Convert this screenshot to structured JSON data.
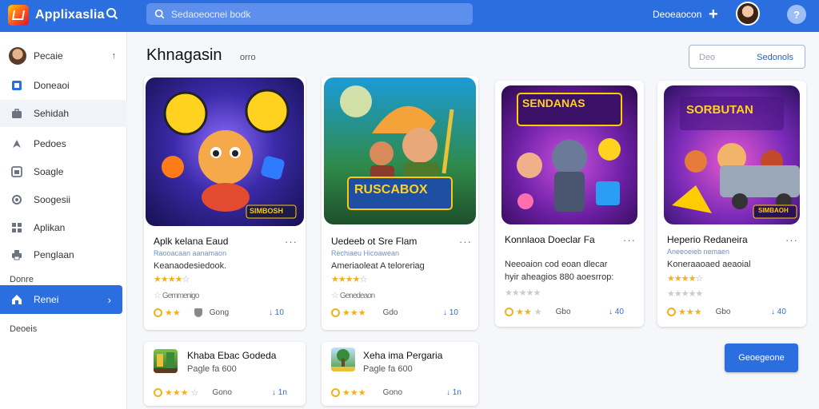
{
  "app": {
    "title": "Applixaslia"
  },
  "topbar": {
    "search_placeholder": "Sedaoeocnei bodk",
    "link": "Deoeaocon",
    "plus": "+",
    "help": "?"
  },
  "sidebar": {
    "items": [
      {
        "label": "Pecaie",
        "icon": "avatar",
        "extra": "↑"
      },
      {
        "label": "Doneaoi",
        "icon": "image-icon"
      },
      {
        "label": "Sehidah",
        "icon": "briefcase-icon"
      },
      {
        "label": "Pedoes",
        "icon": "rocket-icon"
      },
      {
        "label": "Soagle",
        "icon": "image-icon"
      },
      {
        "label": "Soogesii",
        "icon": "circle-icon"
      },
      {
        "label": "Aplikan",
        "icon": "grid-icon"
      },
      {
        "label": "Penglaan",
        "icon": "printer-icon"
      }
    ],
    "heading_1": "Donre",
    "active_item": {
      "label": "Renei",
      "icon": "home-icon",
      "chevron": "›"
    },
    "heading_2": "Deoeis"
  },
  "main": {
    "title": "Khnagasin",
    "subtitle": "orro",
    "outline_button": {
      "placeholder": "Deo",
      "label": "Sedonols"
    },
    "primary_button": "Geoegeone"
  },
  "cards": [
    {
      "title": "Aplk kelana Eaud",
      "more": "···",
      "line1": "Raooacaan aanamaon",
      "line2": "Keanaodesiedook.",
      "rating_stars": 4,
      "rating_text": "",
      "row2_text": "Gemmenigo",
      "row2_stars": 0,
      "footer": {
        "stars": 2,
        "text": "Gong",
        "download": "↓ 10"
      },
      "thumb_badge": "SIMBOSH"
    },
    {
      "title": "Uedeeb ot Sre Flam",
      "more": "···",
      "line1": "Rechiaeu Hicoawean",
      "line2": "Ameriaoleat A teloreriag",
      "rating_stars": 4,
      "rating_text": "",
      "row2_text": "Genedeaon",
      "row2_stars": 0,
      "footer": {
        "stars": 3,
        "text": "Gdo",
        "download": "↓ 10"
      },
      "thumb_badge": "RUSCABOX"
    },
    {
      "title": "Konnlaoa Doeclar Fa",
      "more": "···",
      "line1": "",
      "line2": "Neeoaion cod eoan dlecar",
      "line3": "hyir aheagios 880 aoesrrop:",
      "rating_stars": 0,
      "rating_text": "",
      "row2_text": "",
      "row2_stars": 5,
      "footer": {
        "stars": 2,
        "text": "Gbo",
        "download": "↓ 40"
      },
      "thumb_badge": "SENDANAS"
    },
    {
      "title": "Heperio Redaneira",
      "more": "···",
      "line1": "Aneeoeieb nemaen",
      "line2": "Koneraaoaed aeaoial",
      "rating_stars": 4,
      "rating_text": "",
      "row2_text": "",
      "row2_stars": 5,
      "footer": {
        "stars": 3,
        "text": "Gbo",
        "download": "↓ 40"
      },
      "thumb_badge": "SIMBAOH"
    },
    {
      "title": "Khaba Ebac Godeda",
      "more": "",
      "line1": "Pagle fa 600",
      "line2": "",
      "rating_stars": 0,
      "rating_text": "",
      "row2_text": "",
      "row2_stars": 0,
      "footer": {
        "stars": 4,
        "text": "Gono",
        "download": "↓ 1n"
      },
      "thumb_badge": ""
    },
    {
      "title": "Xeha ima Pergaria",
      "more": "",
      "line1": "Pagle fa 600",
      "line2": "",
      "rating_stars": 0,
      "rating_text": "",
      "row2_text": "",
      "row2_stars": 0,
      "footer": {
        "stars": 3,
        "text": "Gono",
        "download": "↓ 1n"
      },
      "thumb_badge": ""
    }
  ],
  "colors": {
    "accent": "#2b6ee0",
    "star": "#f2b01e",
    "link": "#2b5fb8"
  }
}
